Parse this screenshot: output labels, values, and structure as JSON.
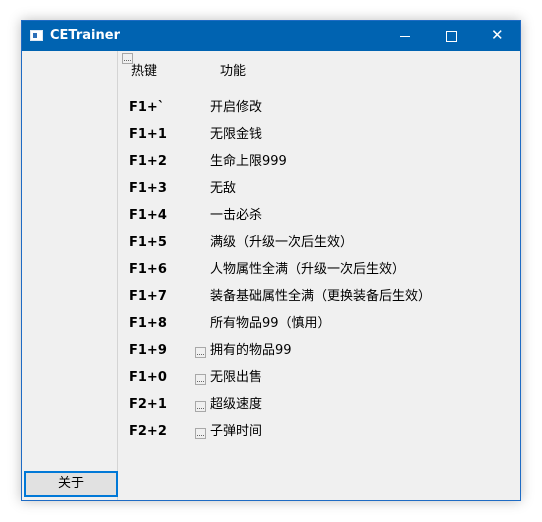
{
  "window": {
    "title": "CETrainer",
    "close_symbol": "✕"
  },
  "left_panel": {
    "about_label": "关于"
  },
  "table": {
    "hotkey_header": "热键",
    "function_header": "功能",
    "rows": [
      {
        "key": "F1+`",
        "function": "开启修改"
      },
      {
        "key": "F1+1",
        "function": "无限金钱"
      },
      {
        "key": "F1+2",
        "function": "生命上限999"
      },
      {
        "key": "F1+3",
        "function": "无敌"
      },
      {
        "key": "F1+4",
        "function": "一击必杀"
      },
      {
        "key": "F1+5",
        "function": "满级（升级一次后生效）"
      },
      {
        "key": "F1+6",
        "function": "人物属性全满（升级一次后生效）"
      },
      {
        "key": "F1+7",
        "function": "装备基础属性全满（更换装备后生效）"
      },
      {
        "key": "F1+8",
        "function": "所有物品99（慎用）"
      },
      {
        "key": "F1+9",
        "function": "拥有的物品99"
      },
      {
        "key": "F1+0",
        "function": "无限出售"
      },
      {
        "key": "F2+1",
        "function": "超级速度"
      },
      {
        "key": "F2+2",
        "function": "子弹时间"
      }
    ]
  },
  "colors": {
    "titlebar": "#0063b1",
    "window_bg": "#f0f0f0",
    "focus_border": "#0078d7"
  },
  "icons": {
    "app": "application-window-icon",
    "minimize": "minimize-icon",
    "maximize": "maximize-icon",
    "close": "close-icon",
    "toggle": "toggle-box-icon"
  }
}
